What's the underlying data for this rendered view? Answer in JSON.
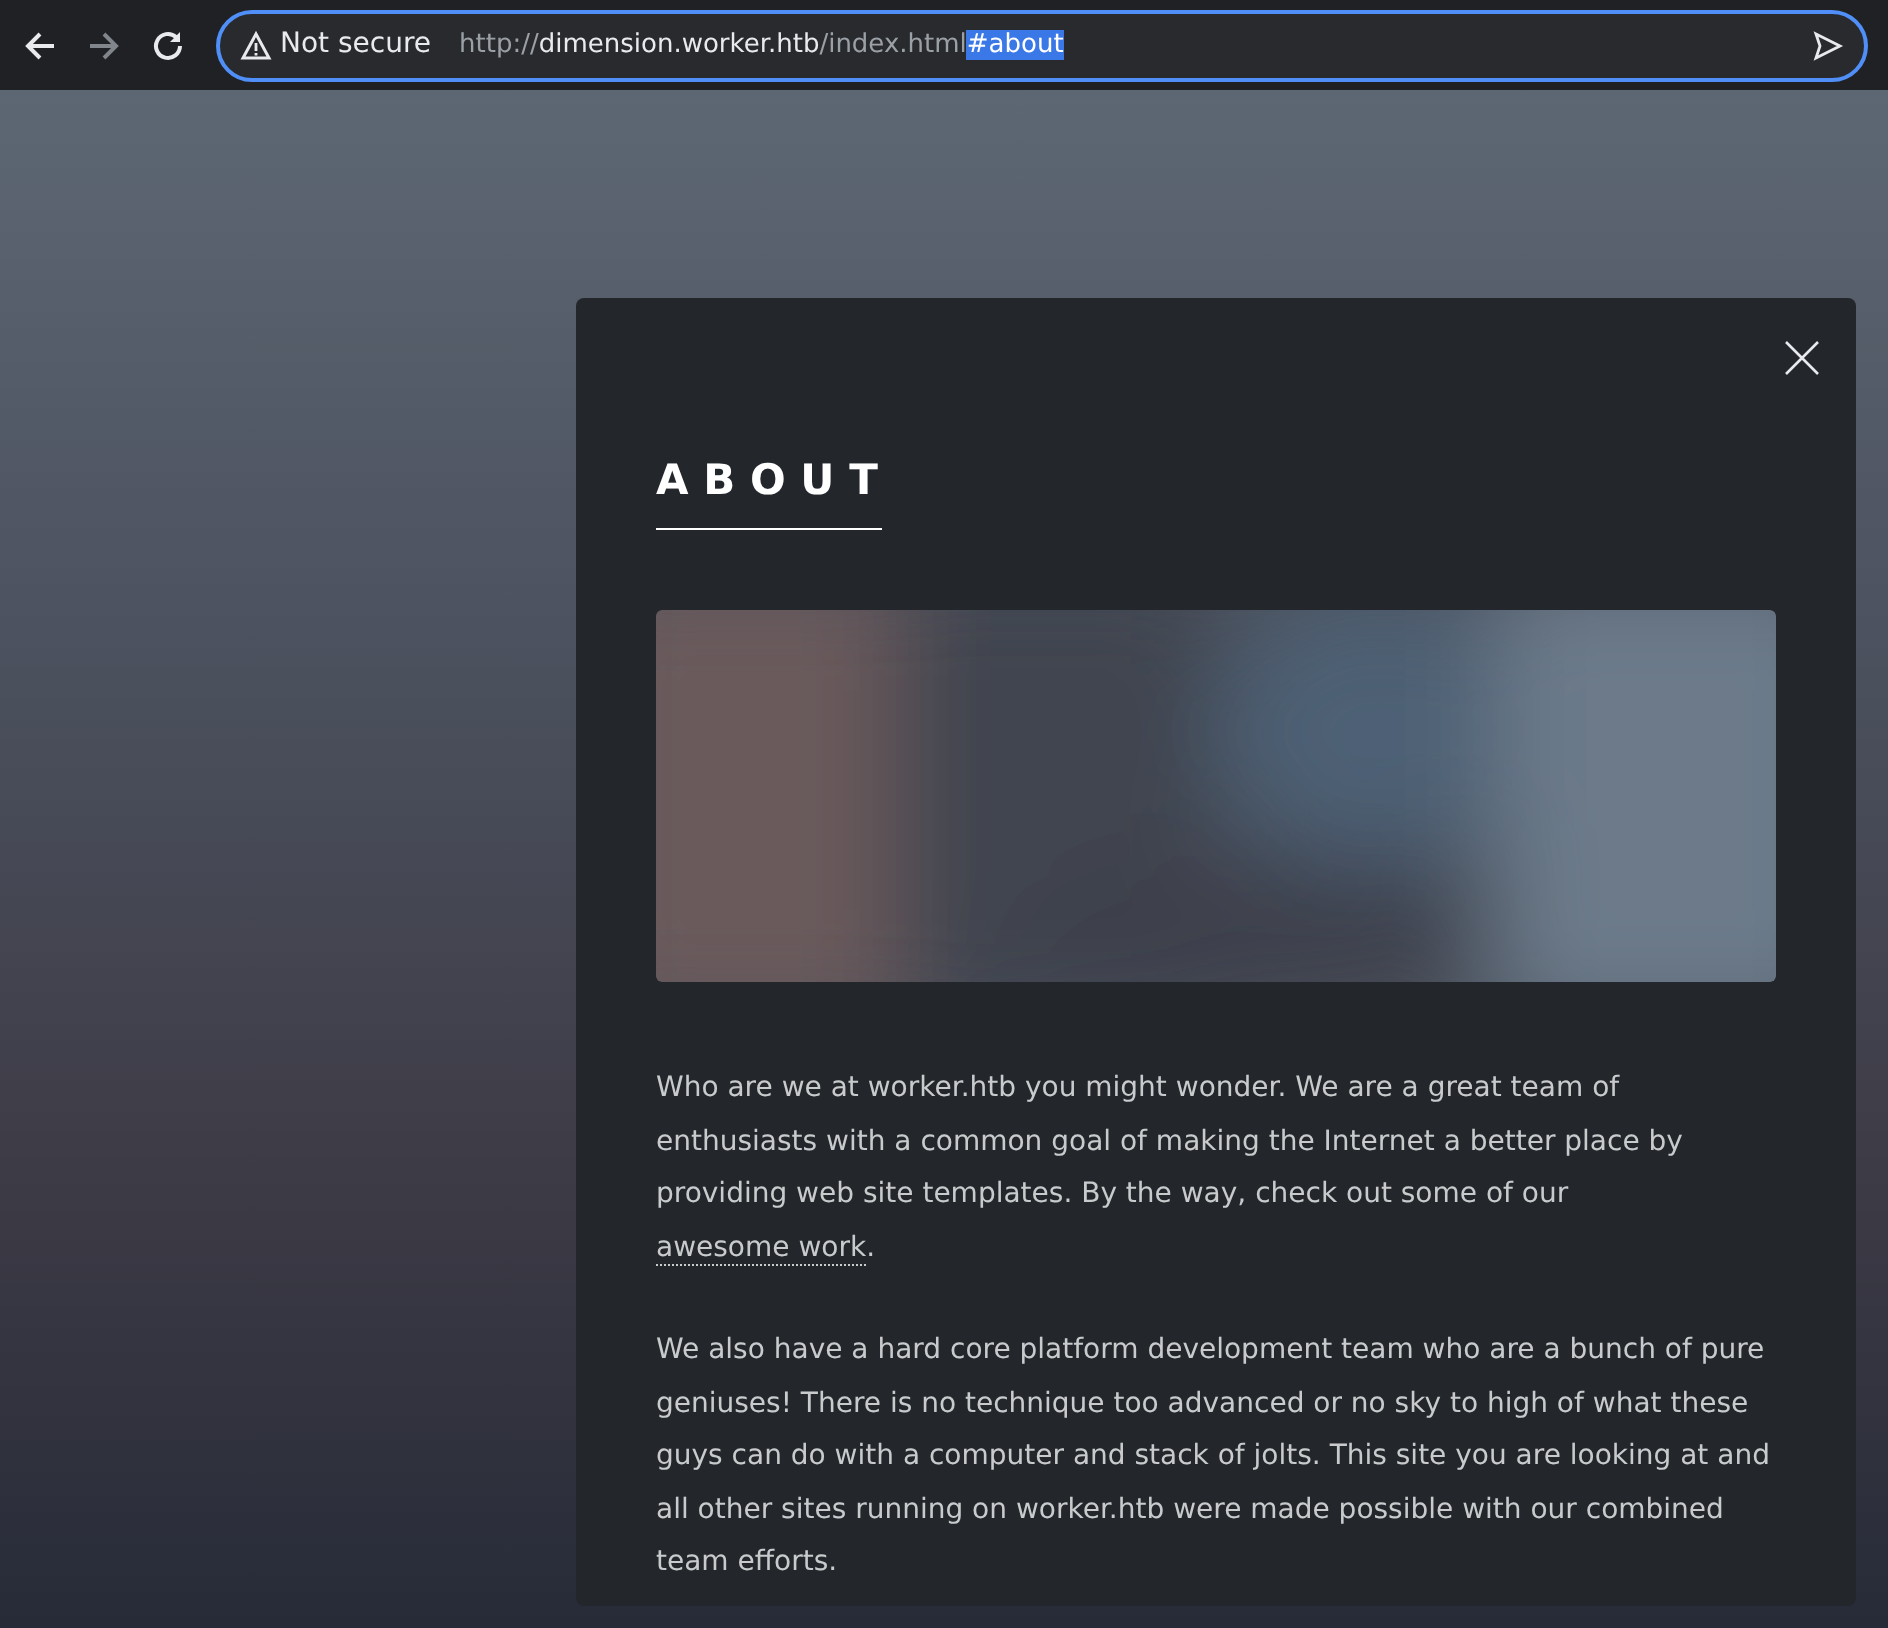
{
  "browser": {
    "security_label": "Not secure",
    "url_parts": [
      {
        "kind": "dim",
        "text": "http://"
      },
      {
        "kind": "host",
        "text": "dimension.worker.htb"
      },
      {
        "kind": "dim",
        "text": "/index.html"
      },
      {
        "kind": "selected",
        "text": "#about"
      }
    ]
  },
  "modal": {
    "title": "ABOUT",
    "image": {
      "kind": "picture"
    },
    "paragraphs": [
      [
        {
          "kind": "text",
          "text": "Who are we at worker.htb you might wonder. We are a great team of enthusiasts with a common goal of making the Internet a better place by providing web site templates. By the way, check out some of our "
        },
        {
          "kind": "link",
          "text": "awesome work"
        },
        {
          "kind": "text",
          "text": "."
        }
      ],
      [
        {
          "kind": "text",
          "text": "We also have a hard core platform development team who are a bunch of pure geniuses! There is no technique too advanced or no sky to high of what these guys can do with a computer and stack of jolts. This site you are looking at and all other sites running on worker.htb were made possible with our combined team efforts."
        }
      ]
    ]
  }
}
